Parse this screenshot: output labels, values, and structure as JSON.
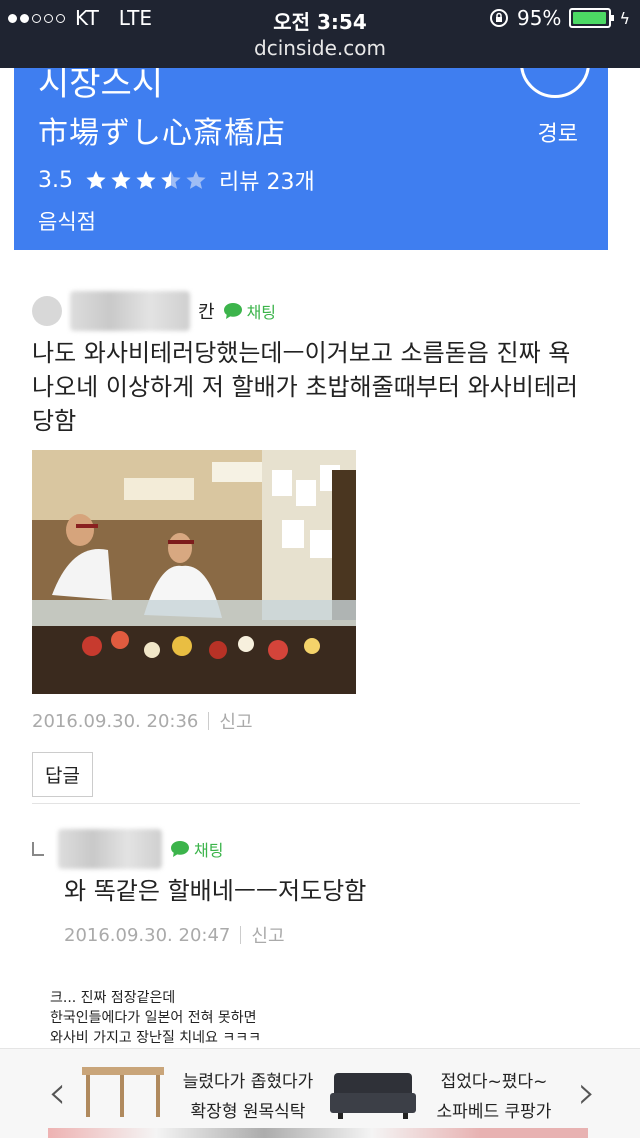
{
  "status_bar": {
    "carrier": "KT",
    "network": "LTE",
    "time": "오전 3:54",
    "battery": "95%",
    "url": "dcinside.com"
  },
  "place_card": {
    "name_ko": "시장스시",
    "name_ja": "市場ずし心斎橋店",
    "route_label": "경로",
    "rating": 3.5,
    "rating_text": "3.5",
    "review_label": "리뷰 23개",
    "category": "음식점"
  },
  "comments": [
    {
      "user_suffix": "칸",
      "badge": "채팅",
      "body_line1": "나도 와사비테러당했는데ㅡ이거보고 소름돋음 진짜 욕",
      "body_line2": "나오네 이상하게 저 할배가 초밥해줄때부터 와사비테러",
      "body_line3": "당함",
      "timestamp": "2016.09.30. 20:36",
      "report": "신고",
      "reply_button": "답글"
    },
    {
      "badge": "채팅",
      "body": "와 똑같은 할배네ㅡㅡ저도당함",
      "timestamp": "2016.09.30. 20:47",
      "report": "신고"
    }
  ],
  "tail_text": [
    "크... 진짜 점장같은데",
    "한국인들에다가 일본어 전혀 못하면",
    "와사비 가지고 장난질 치네요 ㅋㅋㅋ"
  ],
  "ad": {
    "item1_line1": "늘렸다가 좁혔다가",
    "item1_line2": "확장형 원목식탁",
    "item2_line1": "접었다~폈다~",
    "item2_line2": "소파베드 쿠팡가"
  },
  "colors": {
    "card_blue": "#3f7ef0",
    "status_bg": "#1f2431",
    "chat_green": "#3cb44b"
  }
}
